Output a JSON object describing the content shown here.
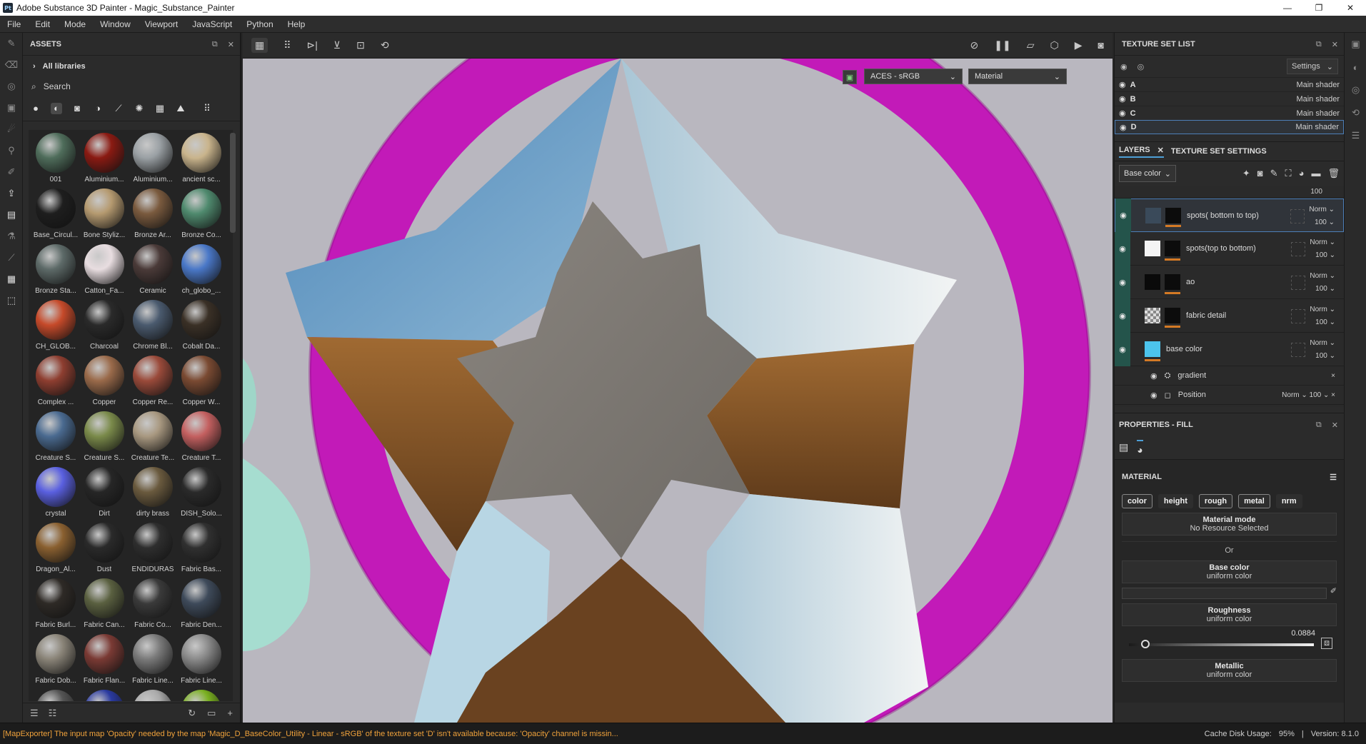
{
  "window": {
    "title": "Adobe Substance 3D Painter - Magic_Substance_Painter",
    "app_icon": "Pt",
    "minimize": "—",
    "maximize": "❐",
    "close": "✕"
  },
  "menu": [
    "File",
    "Edit",
    "Mode",
    "Window",
    "Viewport",
    "JavaScript",
    "Python",
    "Help"
  ],
  "assets": {
    "title": "ASSETS",
    "library": "All libraries",
    "search_placeholder": "Search",
    "materials": [
      "001",
      "Aluminium...",
      "Aluminium...",
      "ancient sc...",
      "Base_Circul...",
      "Bone Styliz...",
      "Bronze Ar...",
      "Bronze Co...",
      "Bronze Sta...",
      "Catton_Fa...",
      "Ceramic",
      "ch_globo_...",
      "CH_GLOB...",
      "Charcoal",
      "Chrome Bl...",
      "Cobalt Da...",
      "Complex ...",
      "Copper",
      "Copper Re...",
      "Copper W...",
      "Creature S...",
      "Creature S...",
      "Creature Te...",
      "Creature T...",
      "crystal",
      "Dirt",
      "dirty brass",
      "DISH_Solo...",
      "Dragon_Al...",
      "Dust",
      "ENDIDURAS",
      "Fabric Bas...",
      "Fabric Burl...",
      "Fabric Can...",
      "Fabric Co...",
      "Fabric Den...",
      "Fabric Dob...",
      "Fabric Flan...",
      "Fabric Line...",
      "Fabric Line...",
      "",
      "",
      "",
      ""
    ],
    "material_colors": [
      "#4f6d5b",
      "#8a1a12",
      "#9aa0a4",
      "#c9b48c",
      "#1e1e1e",
      "#b59a70",
      "#7a5a3e",
      "#4f8a6e",
      "#5d6a68",
      "#e8dde0",
      "#4a3a38",
      "#4a78c8",
      "#c64a2a",
      "#2a2a2a",
      "#4a5a6e",
      "#3a3026",
      "#8e3e30",
      "#9a6a4a",
      "#9a4a3a",
      "#7a4a32",
      "#4a6a90",
      "#7a8a4a",
      "#a89880",
      "#c46060",
      "#5a60e0",
      "#262626",
      "#6a5a3e",
      "#2a2a2a",
      "#8a6030",
      "#2a2a2a",
      "#2e2e2e",
      "#303030",
      "#2e2a26",
      "#5a6040",
      "#3a3a3a",
      "#3e4a5a",
      "#8a8478",
      "#7a3a34",
      "#7a7a7a",
      "#8a8a8a",
      "#555555",
      "#2a3aa0",
      "#aaaaaa",
      "#7ab020"
    ]
  },
  "viewport": {
    "color_space": "ACES - sRGB",
    "display_mode": "Material"
  },
  "texture_set_list": {
    "title": "TEXTURE SET LIST",
    "settings_label": "Settings",
    "sets": [
      {
        "name": "A",
        "shader": "Main shader"
      },
      {
        "name": "B",
        "shader": "Main shader"
      },
      {
        "name": "C",
        "shader": "Main shader"
      },
      {
        "name": "D",
        "shader": "Main shader"
      }
    ]
  },
  "layers_panel": {
    "tab_layers": "LAYERS",
    "tab_texture_settings": "TEXTURE SET SETTINGS",
    "channel": "Base color",
    "top_opacity": "100",
    "layers": [
      {
        "name": "spots( bottom to top)",
        "blend": "Norm",
        "opacity": "100",
        "thumb": "#3a4a5a"
      },
      {
        "name": "spots(top to bottom)",
        "blend": "Norm",
        "opacity": "100",
        "thumb": "#f4f4f4"
      },
      {
        "name": "ao",
        "blend": "Norm",
        "opacity": "100",
        "thumb": "#0a0a0a"
      },
      {
        "name": "fabric detail",
        "blend": "Norm",
        "opacity": "100",
        "thumb": "#9a9a9a"
      },
      {
        "name": "base color",
        "blend": "Norm",
        "opacity": "100",
        "thumb": "#4cc4ec"
      }
    ],
    "effects": [
      {
        "name": "gradient",
        "right": "×"
      },
      {
        "name": "Position",
        "right": "Norm ⌄  100 ⌄  ×"
      }
    ]
  },
  "properties": {
    "title": "PROPERTIES - FILL",
    "section": "MATERIAL",
    "channels": [
      "color",
      "height",
      "rough",
      "metal",
      "nrm"
    ],
    "material_mode_title": "Material mode",
    "material_mode_value": "No Resource Selected",
    "or_label": "Or",
    "base_color_title": "Base color",
    "base_color_value": "uniform color",
    "roughness_title": "Roughness",
    "roughness_value": "uniform color",
    "roughness_number": "0.0884",
    "roughness_fraction": 0.0884,
    "metallic_title": "Metallic",
    "metallic_value": "uniform color"
  },
  "status": {
    "message": "[MapExporter] The input map 'Opacity' needed by the map 'Magic_D_BaseColor_Utility - Linear - sRGB' of the texture set 'D' isn't available because: 'Opacity' channel is missin...",
    "cache": "Cache Disk Usage:",
    "cache_value": "95%",
    "version": "Version: 8.1.0"
  },
  "colors": {
    "ring": "#c21ab8",
    "background": "#b9b7bf",
    "star_face": "#7d7872",
    "star_side_blue": "#5c8fb8",
    "star_side_brown": "#8a5a2e",
    "accent": "#4d9fd6"
  }
}
